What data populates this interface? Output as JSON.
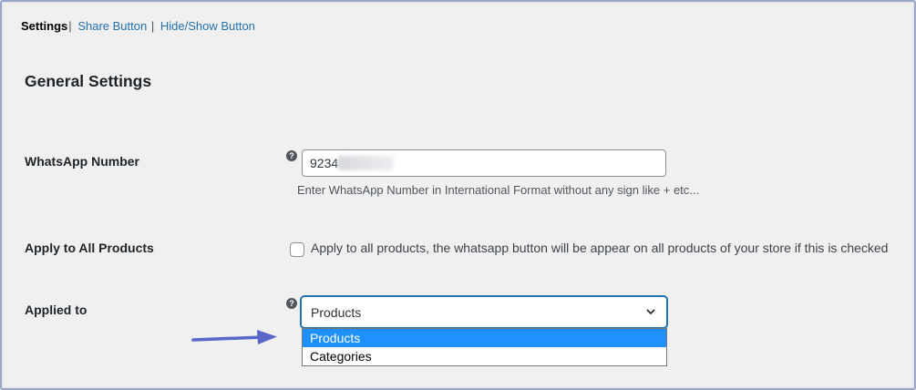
{
  "subnav": {
    "current": "Settings",
    "separator": "|",
    "links": [
      "Share Button",
      "Hide/Show Button"
    ]
  },
  "page": {
    "title": "General Settings"
  },
  "fields": {
    "whatsapp": {
      "label": "WhatsApp Number",
      "value": "9234",
      "description": "Enter WhatsApp Number in International Format without any sign like + etc..."
    },
    "apply_all": {
      "label": "Apply to All Products",
      "checked": false,
      "checkbox_label": "Apply to all products, the whatsapp button will be appear on all products of your store if this is checked"
    },
    "applied_to": {
      "label": "Applied to",
      "selected": "Products",
      "options": [
        "Products",
        "Categories"
      ]
    }
  },
  "help_icon_glyph": "?",
  "colors": {
    "link": "#2271b1",
    "focus_border": "#2271b1",
    "option_highlight": "#1e90ff",
    "arrow": "#5a67c8",
    "background": "#f0f0f1"
  }
}
